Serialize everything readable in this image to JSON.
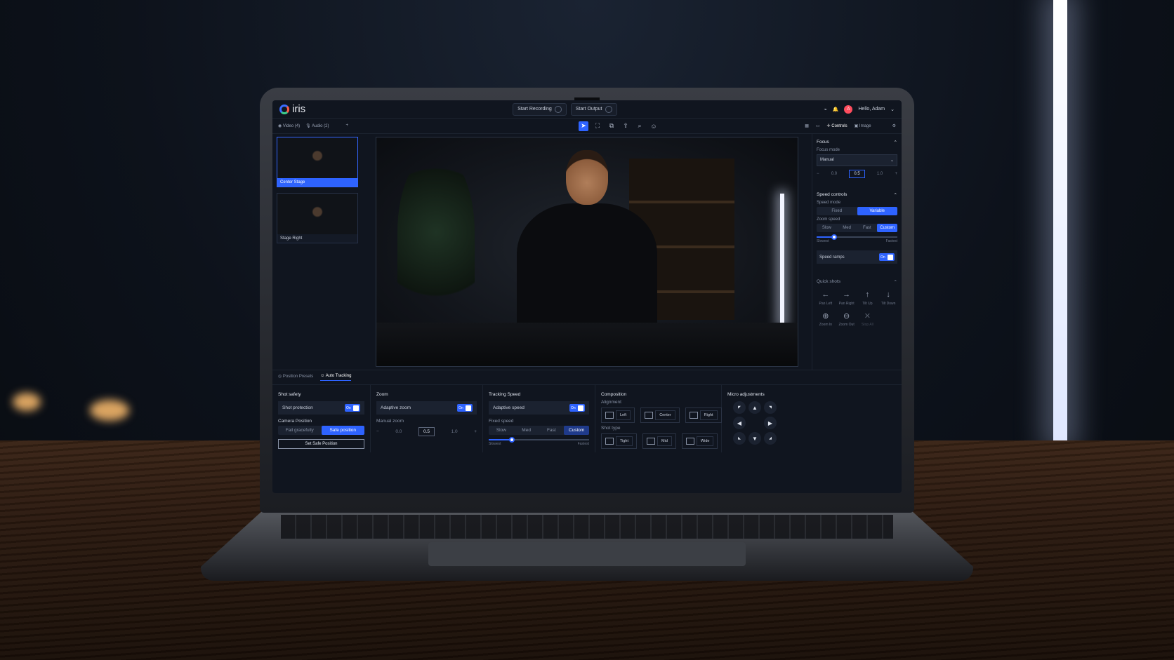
{
  "app": {
    "logo": "iris",
    "start_recording": "Start Recording",
    "start_output": "Start Output",
    "greeting": "Hello, Adam",
    "avatar_initial": "A"
  },
  "tabs": {
    "video": "Video (4)",
    "audio": "Audio (2)",
    "add": "+"
  },
  "right_tabs": {
    "controls": "Controls",
    "image": "Image"
  },
  "sources": [
    {
      "label": "Center Stage"
    },
    {
      "label": "Stage Right"
    }
  ],
  "focus": {
    "title": "Focus",
    "mode_label": "Focus mode",
    "mode_value": "Manual",
    "min": "0.0",
    "value": "0.5",
    "max": "1.0"
  },
  "speed": {
    "title": "Speed controls",
    "mode_label": "Speed mode",
    "fixed": "Fixed",
    "variable": "Variable",
    "zoom_label": "Zoom speed",
    "slow": "Slow",
    "med": "Med",
    "fast": "Fast",
    "custom": "Custom",
    "slowest": "Slowest",
    "fastest": "Fastest",
    "zoom_speed_fraction": 0.22,
    "ramps_label": "Speed ramps",
    "on": "On"
  },
  "quick": {
    "title": "Quick shots",
    "items": [
      "Pan Left",
      "Pan Right",
      "Tilt Up",
      "Tilt Down",
      "Zoom In",
      "Zoom Out",
      "Stop All"
    ]
  },
  "bottom_tabs": {
    "presets": "Position Presets",
    "auto": "Auto Tracking"
  },
  "shot_safety": {
    "title": "Shot safety",
    "protection": "Shot protection",
    "cam_pos": "Camera Position",
    "fail": "Fail gracefully",
    "safe": "Safe position",
    "set_safe": "Set Safe Position"
  },
  "zoom": {
    "title": "Zoom",
    "adaptive": "Adaptive zoom",
    "manual": "Manual zoom",
    "min": "0.0",
    "value": "0.5",
    "max": "1.0"
  },
  "tracking": {
    "title": "Tracking Speed",
    "adaptive": "Adaptive speed",
    "fixed": "Fixed speed",
    "slow": "Slow",
    "med": "Med",
    "fast": "Fast",
    "custom": "Custom",
    "slowest": "Slowest",
    "fastest": "Fastest",
    "speed_fraction": 0.23
  },
  "composition": {
    "title": "Composition",
    "alignment": "Alignment",
    "left": "Left",
    "center": "Center",
    "right": "Right",
    "shot_type": "Shot type",
    "tight": "Tight",
    "mid": "Mid",
    "wide": "Wide"
  },
  "micro": {
    "title": "Micro adjustments"
  },
  "colors": {
    "accent": "#2e63ff"
  }
}
